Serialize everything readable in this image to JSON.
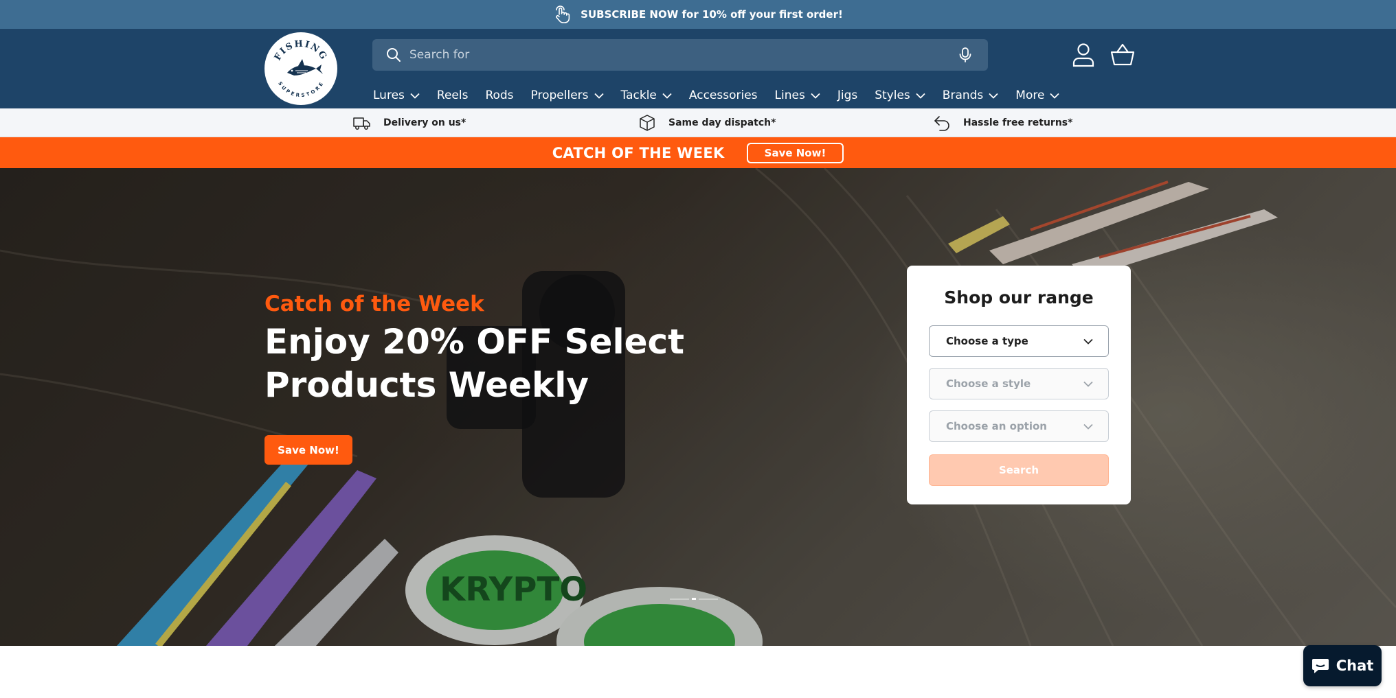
{
  "promo": {
    "icon": "tap-hand-icon",
    "text": "SUBSCRIBE NOW for 10% off your first order!"
  },
  "header": {
    "logo": {
      "top_text": "FISHING",
      "bottom_text": "SUPERSTORE"
    },
    "search": {
      "placeholder": "Search for",
      "icon": "search-icon",
      "mic_icon": "microphone-icon"
    },
    "account_icon": "account-icon",
    "cart_icon": "basket-icon",
    "nav": [
      {
        "label": "Lures",
        "has_dropdown": true
      },
      {
        "label": "Reels",
        "has_dropdown": false
      },
      {
        "label": "Rods",
        "has_dropdown": false
      },
      {
        "label": "Propellers",
        "has_dropdown": true
      },
      {
        "label": "Tackle",
        "has_dropdown": true
      },
      {
        "label": "Accessories",
        "has_dropdown": false
      },
      {
        "label": "Lines",
        "has_dropdown": true
      },
      {
        "label": "Jigs",
        "has_dropdown": false
      },
      {
        "label": "Styles",
        "has_dropdown": true
      },
      {
        "label": "Brands",
        "has_dropdown": true
      },
      {
        "label": "More",
        "has_dropdown": true
      }
    ]
  },
  "features": [
    {
      "icon": "delivery-truck-icon",
      "label": "Delivery on us*"
    },
    {
      "icon": "box-icon",
      "label": "Same day dispatch*"
    },
    {
      "icon": "return-arrow-icon",
      "label": "Hassle free returns*"
    }
  ],
  "catch_bar": {
    "title": "CATCH OF THE WEEK",
    "button": "Save Now!"
  },
  "hero": {
    "eyebrow": "Catch of the Week",
    "headline": "Enjoy 20% OFF Select Products Weekly",
    "button": "Save Now!",
    "slides_total": 3,
    "active_slide": 2
  },
  "shop_panel": {
    "title": "Shop our range",
    "selects": [
      {
        "label": "Choose a type",
        "disabled": false
      },
      {
        "label": "Choose a style",
        "disabled": true
      },
      {
        "label": "Choose an option",
        "disabled": true
      }
    ],
    "search_button": "Search"
  },
  "chat": {
    "label": "Chat",
    "icon": "chat-bubble-icon"
  },
  "colors": {
    "accent": "#ff5a0f",
    "header": "#1e4468",
    "promo": "#3e6d92",
    "chat": "#061a2e"
  }
}
